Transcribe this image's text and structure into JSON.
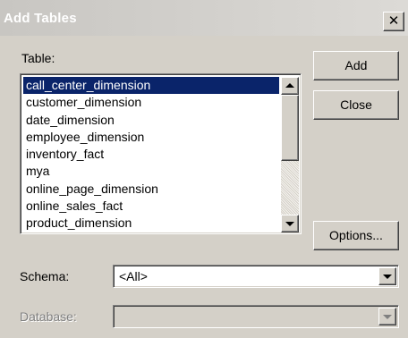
{
  "window": {
    "title": "Add Tables",
    "close_glyph": "✕"
  },
  "table_label": "Table:",
  "tables": [
    "call_center_dimension",
    "customer_dimension",
    "date_dimension",
    "employee_dimension",
    "inventory_fact",
    "mya",
    "online_page_dimension",
    "online_sales_fact",
    "product_dimension"
  ],
  "selected_table": "call_center_dimension",
  "buttons": {
    "add": "Add",
    "close": "Close",
    "options": "Options..."
  },
  "schema": {
    "label": "Schema:",
    "value": "<All>"
  },
  "database": {
    "label": "Database:",
    "value": ""
  },
  "colors": {
    "selection": "#0a246a",
    "face": "#d4d0c8",
    "title_text": "#ffffff"
  }
}
